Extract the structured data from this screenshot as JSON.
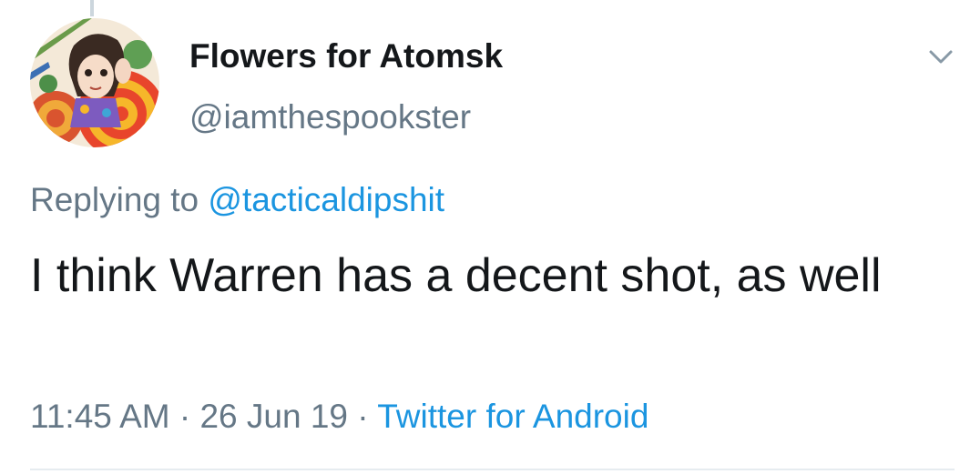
{
  "tweet": {
    "author": {
      "display_name": "Flowers for Atomsk",
      "handle": "@iamthespookster",
      "avatar_icon": "avatar-illustration"
    },
    "reply_prefix": "Replying to",
    "reply_mention": "@tacticaldipshit",
    "text": "I think Warren has a decent shot, as well",
    "time": "11:45 AM",
    "separator": "·",
    "date": "26 Jun 19",
    "source": "Twitter for Android",
    "menu_icon": "chevron-down-icon"
  },
  "colors": {
    "text_primary": "#14171a",
    "text_secondary": "#657786",
    "link": "#1b95e0",
    "thread_line": "#ccd6dd",
    "divider": "#e6ecf0"
  }
}
